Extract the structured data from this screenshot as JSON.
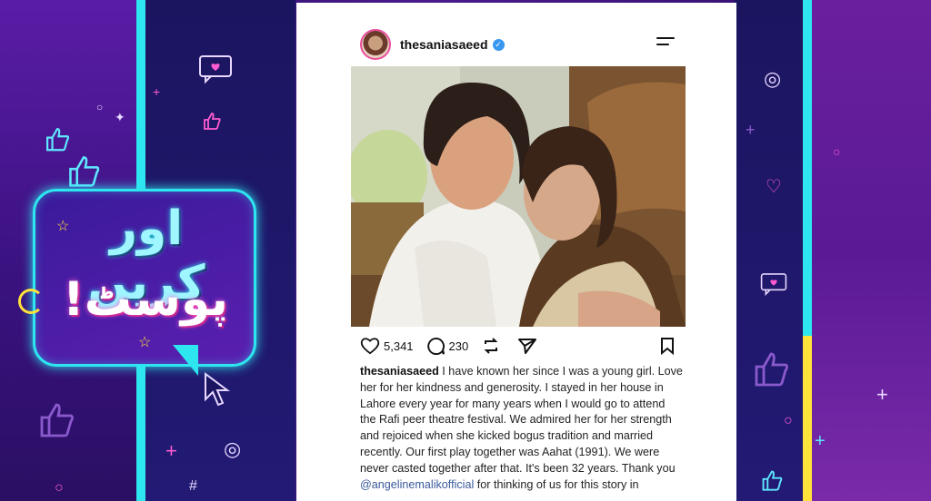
{
  "graphic": {
    "headline_line1": "اور کریں",
    "headline_line2": "پوسٹ!"
  },
  "post": {
    "username": "thesaniasaeed",
    "verified": true,
    "likes": "5,341",
    "comments": "230",
    "caption_user": "thesaniasaeed",
    "caption_text": " I have known her since I was a young girl. Love her for her kindness and generosity.  I stayed in her house in Lahore every year  for many years when I would go to attend the Rafi peer theatre festival. We admired her for her strength and rejoiced when she kicked bogus tradition and married recently. Our first play together was Aahat (1991). We were never casted together after that. It's been 32 years. Thank you ",
    "caption_mention": "@angelinemalikofficial",
    "caption_tail": " for thinking of us for this  story in"
  },
  "icons": {
    "like": "heart-icon",
    "comment": "comment-icon",
    "repost": "repost-icon",
    "share": "share-icon",
    "save": "bookmark-icon",
    "menu": "menu-icon",
    "verified": "verified-badge-icon"
  },
  "colors": {
    "cyan": "#2ee6f0",
    "yellow": "#ffe23a",
    "pink": "#ff5bd0",
    "purple": "#4a1a8c",
    "verified": "#3897f0"
  }
}
